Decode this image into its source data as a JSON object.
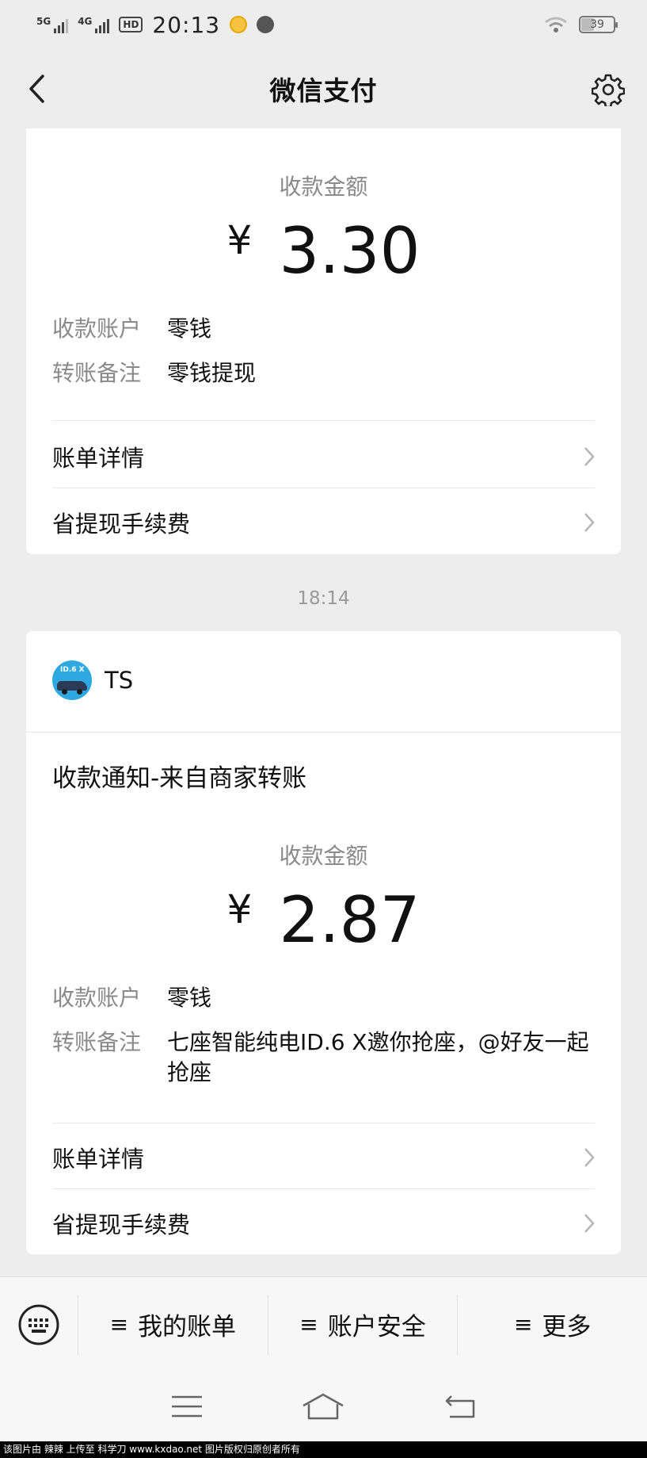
{
  "status_bar": {
    "network_1": "5G",
    "network_2": "4G",
    "hd": "HD",
    "time": "20:13",
    "battery": "39"
  },
  "nav": {
    "title": "微信支付",
    "back_icon": "chevron-left-icon",
    "settings_icon": "gear-icon"
  },
  "card1": {
    "amount_label": "收款金额",
    "currency": "¥",
    "amount": "3.30",
    "account_key": "收款账户",
    "account_value": "零钱",
    "remark_key": "转账备注",
    "remark_value": "零钱提现",
    "row1": "账单详情",
    "row2": "省提现手续费"
  },
  "timestamp": "18:14",
  "card2": {
    "merchant": "TS",
    "avatar_badge": "ID.6 X",
    "notice_title": "收款通知-来自商家转账",
    "amount_label": "收款金额",
    "currency": "¥",
    "amount": "2.87",
    "account_key": "收款账户",
    "account_value": "零钱",
    "remark_key": "转账备注",
    "remark_value": "七座智能纯电ID.6 X邀你抢座，@好友一起抢座",
    "row1": "账单详情",
    "row2": "省提现手续费"
  },
  "menu": {
    "keyboard_icon": "keyboard-icon",
    "items": [
      {
        "label": "我的账单"
      },
      {
        "label": "账户安全"
      },
      {
        "label": "更多"
      }
    ],
    "menu_glyph": "≡"
  },
  "system_nav": [
    "menu-icon",
    "home-icon",
    "back-icon"
  ],
  "watermark": "该图片由 辣辣 上传至 科学刀 www.kxdao.net 图片版权归原创者所有"
}
